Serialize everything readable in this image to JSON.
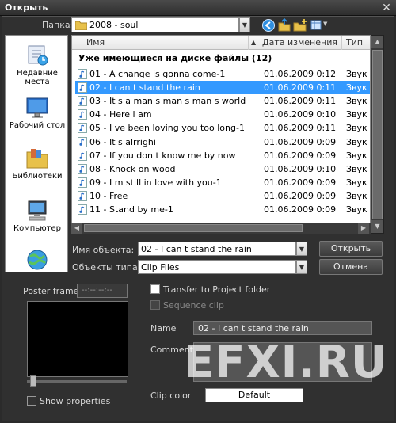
{
  "window": {
    "title": "Открыть"
  },
  "toolbar": {
    "folder_label": "Папка:",
    "folder_value": "2008 - soul"
  },
  "places": [
    {
      "label": "Недавние места",
      "icon": "recent-places-icon"
    },
    {
      "label": "Рабочий стол",
      "icon": "desktop-icon"
    },
    {
      "label": "Библиотеки",
      "icon": "libraries-icon"
    },
    {
      "label": "Компьютер",
      "icon": "computer-icon"
    }
  ],
  "list": {
    "columns": {
      "name": "Имя",
      "date": "Дата изменения",
      "type": "Тип"
    },
    "group_header": "Уже имеющиеся на диске файлы (12)",
    "rows": [
      {
        "name": "01 - A change is gonna come-1",
        "date": "01.06.2009 0:12",
        "type": "Звук в"
      },
      {
        "name": "02 - I can t stand the rain",
        "date": "01.06.2009 0:11",
        "type": "Звук в"
      },
      {
        "name": "03 - It s a man s man s man s world",
        "date": "01.06.2009 0:11",
        "type": "Звук в"
      },
      {
        "name": "04 - Here i am",
        "date": "01.06.2009 0:10",
        "type": "Звук в"
      },
      {
        "name": "05 - I ve been loving you too long-1",
        "date": "01.06.2009 0:11",
        "type": "Звук в"
      },
      {
        "name": "06 - It s alrrighi",
        "date": "01.06.2009 0:09",
        "type": "Звук в"
      },
      {
        "name": "07 - If you don t know me by now",
        "date": "01.06.2009 0:09",
        "type": "Звук в"
      },
      {
        "name": "08 - Knock on wood",
        "date": "01.06.2009 0:10",
        "type": "Звук в"
      },
      {
        "name": "09 - I m still in love with you-1",
        "date": "01.06.2009 0:09",
        "type": "Звук в"
      },
      {
        "name": "10 - Free",
        "date": "01.06.2009 0:09",
        "type": "Звук в"
      },
      {
        "name": "11 - Stand by me-1",
        "date": "01.06.2009 0:09",
        "type": "Звук в"
      }
    ]
  },
  "form": {
    "object_name_label": "Имя объекта:",
    "object_name_value": "02 - I can t stand the rain",
    "object_type_label": "Объекты типа:",
    "object_type_value": "Clip Files",
    "open_button": "Открыть",
    "cancel_button": "Отмена"
  },
  "clip": {
    "poster_frame_label": "Poster frame",
    "poster_frame_value": "--:--:--:--",
    "transfer_label": "Transfer to Project folder",
    "sequence_label": "Sequence clip",
    "name_label": "Name",
    "name_value": "02 - I can t stand the rain",
    "comment_label": "Comment",
    "clip_color_label": "Clip color",
    "clip_color_value": "Default",
    "show_properties_label": "Show properties"
  },
  "watermark": "EFXI.RU"
}
